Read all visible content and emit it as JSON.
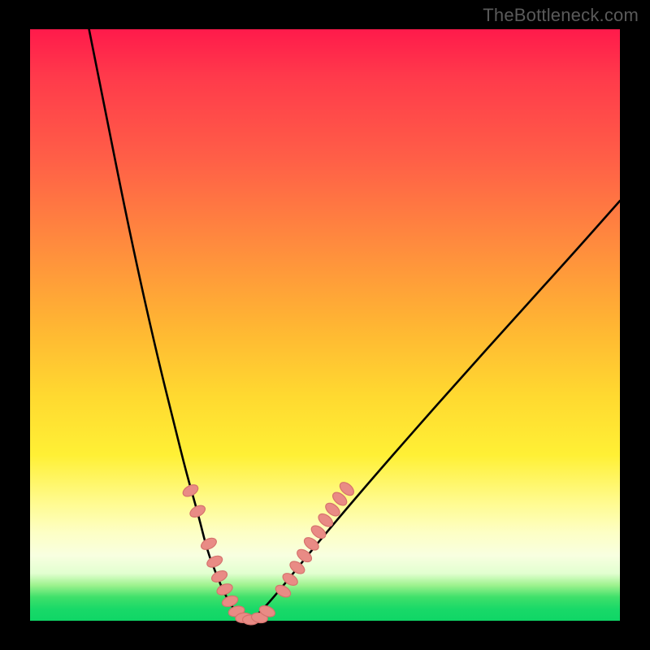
{
  "watermark": "TheBottleneck.com",
  "chart_data": {
    "type": "line",
    "title": "",
    "xlabel": "",
    "ylabel": "",
    "xlim": [
      0,
      100
    ],
    "ylim": [
      0,
      100
    ],
    "gradient_stops": [
      {
        "pct": 0,
        "color": "#ff1a4b"
      },
      {
        "pct": 8,
        "color": "#ff3a4b"
      },
      {
        "pct": 22,
        "color": "#ff5f47"
      },
      {
        "pct": 36,
        "color": "#ff8a3e"
      },
      {
        "pct": 50,
        "color": "#ffb533"
      },
      {
        "pct": 62,
        "color": "#ffd930"
      },
      {
        "pct": 72,
        "color": "#fff035"
      },
      {
        "pct": 80,
        "color": "#fffb8f"
      },
      {
        "pct": 85,
        "color": "#fdffc4"
      },
      {
        "pct": 89,
        "color": "#f8ffe0"
      },
      {
        "pct": 92,
        "color": "#e2ffd0"
      },
      {
        "pct": 94,
        "color": "#9df28e"
      },
      {
        "pct": 96,
        "color": "#3fe06a"
      },
      {
        "pct": 98,
        "color": "#19d968"
      },
      {
        "pct": 100,
        "color": "#0fd666"
      }
    ],
    "series": [
      {
        "name": "left-branch",
        "x": [
          10,
          13,
          16,
          19,
          22,
          24.5,
          26.5,
          28.5,
          30,
          31.5,
          33,
          34.5,
          35.5,
          36.5
        ],
        "y": [
          100,
          85,
          70,
          56,
          43,
          33,
          25,
          18,
          12,
          8,
          4.5,
          2,
          0.7,
          0
        ]
      },
      {
        "name": "right-branch",
        "x": [
          36.5,
          38,
          40,
          43,
          47,
          52,
          58,
          65,
          73,
          82,
          92,
          100
        ],
        "y": [
          0,
          0.5,
          2.5,
          6,
          11,
          17,
          24,
          32,
          41,
          51,
          62,
          71
        ]
      }
    ],
    "marker_style": {
      "fill": "#e98b85",
      "stroke": "#d6736d",
      "rx": 6,
      "ry": 10,
      "stroke_width": 1.2
    },
    "markers_left": [
      {
        "x": 27.2,
        "y": 22.0,
        "rot": 62
      },
      {
        "x": 28.4,
        "y": 18.5,
        "rot": 62
      },
      {
        "x": 30.3,
        "y": 13.0,
        "rot": 64
      },
      {
        "x": 31.3,
        "y": 10.0,
        "rot": 65
      },
      {
        "x": 32.1,
        "y": 7.5,
        "rot": 66
      },
      {
        "x": 33.0,
        "y": 5.3,
        "rot": 68
      },
      {
        "x": 33.9,
        "y": 3.3,
        "rot": 70
      },
      {
        "x": 35.0,
        "y": 1.6,
        "rot": 75
      },
      {
        "x": 36.2,
        "y": 0.5,
        "rot": 85
      },
      {
        "x": 37.4,
        "y": 0.15,
        "rot": 92
      }
    ],
    "markers_right": [
      {
        "x": 38.9,
        "y": 0.5,
        "rot": 100
      },
      {
        "x": 40.2,
        "y": 1.6,
        "rot": 112
      },
      {
        "x": 42.9,
        "y": 5.0,
        "rot": 120
      },
      {
        "x": 44.1,
        "y": 7.0,
        "rot": 122
      },
      {
        "x": 45.3,
        "y": 9.0,
        "rot": 124
      },
      {
        "x": 46.5,
        "y": 11.0,
        "rot": 125
      },
      {
        "x": 47.7,
        "y": 13.0,
        "rot": 126
      },
      {
        "x": 48.9,
        "y": 15.0,
        "rot": 127
      },
      {
        "x": 50.1,
        "y": 17.0,
        "rot": 128
      },
      {
        "x": 51.3,
        "y": 18.8,
        "rot": 129
      },
      {
        "x": 52.5,
        "y": 20.6,
        "rot": 130
      },
      {
        "x": 53.7,
        "y": 22.3,
        "rot": 131
      }
    ]
  }
}
